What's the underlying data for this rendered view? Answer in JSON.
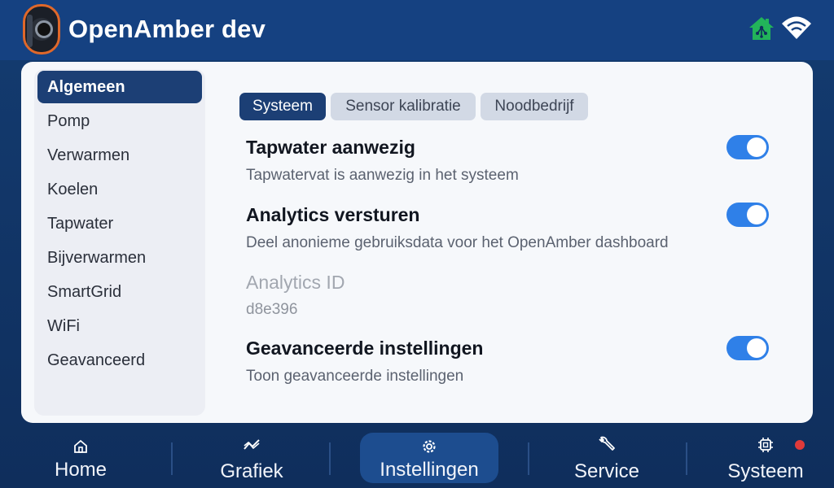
{
  "app": {
    "title": "OpenAmber dev"
  },
  "header": {
    "home_icon": "home-network-icon",
    "wifi_icon": "wifi-icon"
  },
  "sidebar": {
    "items": [
      {
        "label": "Algemeen",
        "active": true
      },
      {
        "label": "Pomp"
      },
      {
        "label": "Verwarmen"
      },
      {
        "label": "Koelen"
      },
      {
        "label": "Tapwater"
      },
      {
        "label": "Bijverwarmen"
      },
      {
        "label": "SmartGrid"
      },
      {
        "label": "WiFi"
      },
      {
        "label": "Geavanceerd"
      }
    ]
  },
  "tabs": [
    {
      "label": "Systeem",
      "active": true
    },
    {
      "label": "Sensor kalibratie"
    },
    {
      "label": "Noodbedrijf"
    }
  ],
  "settings": {
    "tapwater": {
      "title": "Tapwater aanwezig",
      "description": "Tapwatervat is aanwezig in het systeem",
      "enabled": true
    },
    "analytics": {
      "title": "Analytics versturen",
      "description": "Deel anonieme gebruiksdata voor het OpenAmber dashboard",
      "enabled": true
    },
    "analytics_id": {
      "title": "Analytics ID",
      "value": "d8e396"
    },
    "advanced": {
      "title": "Geavanceerde instellingen",
      "description": "Toon geavanceerde instellingen",
      "enabled": true
    }
  },
  "bottom_nav": [
    {
      "label": "Home",
      "icon": "home-icon"
    },
    {
      "label": "Grafiek",
      "icon": "chart-icon"
    },
    {
      "label": "Instellingen",
      "icon": "gear-icon",
      "active": true
    },
    {
      "label": "Service",
      "icon": "wrench-icon"
    },
    {
      "label": "Systeem",
      "icon": "chip-icon",
      "alert": true
    }
  ],
  "colors": {
    "header_bg": "#154181",
    "accent": "#1c3f75",
    "toggle_on": "#2f80e8",
    "alert": "#e03a3a",
    "status_ok": "#22b35a"
  }
}
